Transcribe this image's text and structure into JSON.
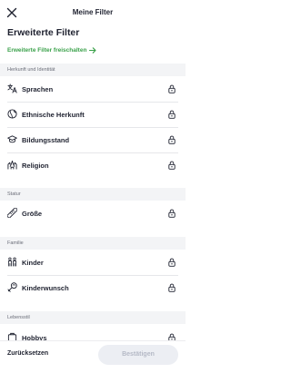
{
  "header": {
    "title": "Meine Filter",
    "close_icon": "close-icon"
  },
  "page_title": "Erweiterte Filter",
  "unlock_link": {
    "label": "Erweiterte Filter freischalten",
    "icon": "arrow-right-icon"
  },
  "colors": {
    "accent_green": "#3aa14a",
    "text": "#1f2230",
    "section_bg": "#f3f4f6",
    "disabled_button_bg": "#eceef3",
    "disabled_button_text": "#b5b9c6"
  },
  "sections": [
    {
      "label": "Herkunft und Identität",
      "items": [
        {
          "label": "Sprachen",
          "icon": "language-icon",
          "locked": true
        },
        {
          "label": "Ethnische Herkunft",
          "icon": "globe-icon",
          "locked": true
        },
        {
          "label": "Bildungsstand",
          "icon": "graduation-cap-icon",
          "locked": true
        },
        {
          "label": "Religion",
          "icon": "religion-icon",
          "locked": true
        }
      ]
    },
    {
      "label": "Statur",
      "items": [
        {
          "label": "Größe",
          "icon": "ruler-icon",
          "locked": true
        }
      ]
    },
    {
      "label": "Familie",
      "items": [
        {
          "label": "Kinder",
          "icon": "children-icon",
          "locked": true
        },
        {
          "label": "Kinderwunsch",
          "icon": "child-wish-icon",
          "locked": true
        }
      ]
    },
    {
      "label": "Lebensstil",
      "items": [
        {
          "label": "Hobbys",
          "icon": "hobbies-icon",
          "locked": true
        }
      ]
    }
  ],
  "footer": {
    "reset_label": "Zurücksetzen",
    "confirm_label": "Bestätigen"
  }
}
